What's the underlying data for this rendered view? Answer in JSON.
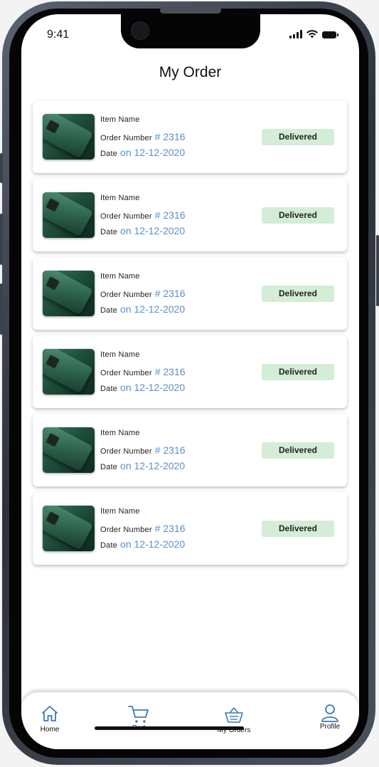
{
  "status_bar": {
    "time": "9:41"
  },
  "header": {
    "title": "My Order"
  },
  "orders": [
    {
      "item_label": "Item Name",
      "order_label": "Order Number",
      "order_number": "# 2316",
      "date_label": "Date",
      "date": "on 12-12-2020",
      "status": "Delivered"
    },
    {
      "item_label": "Item Name",
      "order_label": "Order Number",
      "order_number": "# 2316",
      "date_label": "Date",
      "date": "on 12-12-2020",
      "status": "Delivered"
    },
    {
      "item_label": "Item Name",
      "order_label": "Order Number",
      "order_number": "# 2316",
      "date_label": "Date",
      "date": "on 12-12-2020",
      "status": "Delivered"
    },
    {
      "item_label": "Item Name",
      "order_label": "Order Number",
      "order_number": "# 2316",
      "date_label": "Date",
      "date": "on 12-12-2020",
      "status": "Delivered"
    },
    {
      "item_label": "Item Name",
      "order_label": "Order Number",
      "order_number": "# 2316",
      "date_label": "Date",
      "date": "on 12-12-2020",
      "status": "Delivered"
    },
    {
      "item_label": "Item Name",
      "order_label": "Order Number",
      "order_number": "# 2316",
      "date_label": "Date",
      "date": "on 12-12-2020",
      "status": "Delivered"
    }
  ],
  "bottom_nav": {
    "items": [
      {
        "label": "Home",
        "icon": "home-icon"
      },
      {
        "label": "Cart",
        "icon": "cart-icon"
      },
      {
        "label": "My Orders",
        "icon": "basket-icon"
      },
      {
        "label": "Profile",
        "icon": "user-icon"
      }
    ]
  },
  "colors": {
    "accent": "#5b8fc8",
    "nav_icon": "#3d79b8",
    "status_badge_bg": "#d4edd6",
    "product_green": "#2a5e47"
  }
}
